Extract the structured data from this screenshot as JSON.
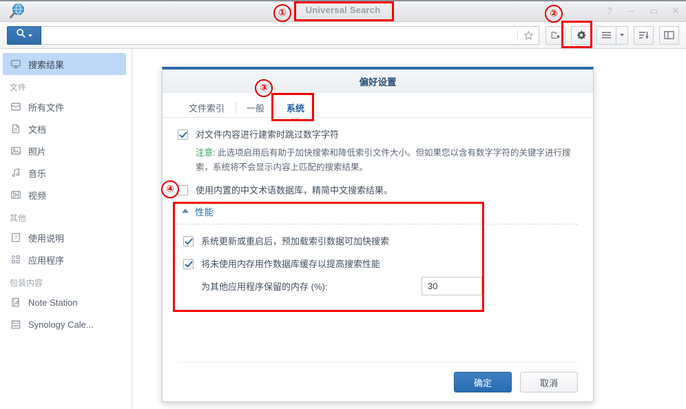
{
  "window": {
    "title": "Universal Search",
    "logo_icon": "magnifier-globe-icon",
    "buttons": [
      {
        "name": "help",
        "glyph": "?"
      },
      {
        "name": "minimize",
        "glyph": "–"
      },
      {
        "name": "maximize",
        "glyph": "▭"
      },
      {
        "name": "close",
        "glyph": "✕"
      }
    ]
  },
  "searchbar": {
    "scope_icon": "search-icon",
    "scope_caret_icon": "caret-down-icon",
    "query": "",
    "placeholder": "",
    "favorite_icon": "star-icon",
    "tools": [
      {
        "name": "new-folder-favorite",
        "icon": "folder-star-icon"
      },
      {
        "name": "settings",
        "icon": "gear-icon"
      },
      {
        "name": "list-view",
        "icon": "list-icon"
      },
      {
        "name": "list-view-more",
        "icon": "caret-down-icon"
      },
      {
        "name": "sort",
        "icon": "sort-descending-icon"
      },
      {
        "name": "panel",
        "icon": "layout-panel-icon"
      }
    ]
  },
  "sidebar": {
    "selected": {
      "label": "搜索结果",
      "icon": "monitor-icon"
    },
    "groups": [
      {
        "title": "文件",
        "items": [
          {
            "label": "所有文件",
            "icon": "archive-icon"
          },
          {
            "label": "文档",
            "icon": "document-icon"
          },
          {
            "label": "照片",
            "icon": "photo-icon"
          },
          {
            "label": "音乐",
            "icon": "music-icon"
          },
          {
            "label": "视频",
            "icon": "video-icon"
          }
        ]
      },
      {
        "title": "其他",
        "items": [
          {
            "label": "使用说明",
            "icon": "question-box-icon"
          },
          {
            "label": "应用程序",
            "icon": "apps-icon"
          }
        ]
      },
      {
        "title": "包装内容",
        "items": [
          {
            "label": "Note Station",
            "icon": "note-icon"
          },
          {
            "label": "Synology Cale...",
            "icon": "calendar-icon"
          }
        ]
      }
    ]
  },
  "dialog": {
    "title": "偏好设置",
    "tabs": [
      {
        "label": "文件索引",
        "active": false
      },
      {
        "label": "一般",
        "active": false
      },
      {
        "label": "系统",
        "active": true
      }
    ],
    "options": [
      {
        "label": "对文件内容进行建索时跳过数字字符",
        "checked": true
      },
      {
        "label": "使用内置的中文术语数据库，精简中文搜索结果。",
        "checked": false
      }
    ],
    "note": {
      "key": "注意:",
      "text": " 此选项启用后有助于加快搜索和降低索引文件大小。但如果您以含有数字字符的关键字进行搜索，系统将不会显示内容上匹配的搜索结果。"
    },
    "performance": {
      "title": "性能",
      "collapse_icon": "chevron-up-icon",
      "options": [
        {
          "label": "系统更新或重启后，预加载索引数据可加快搜索",
          "checked": true
        },
        {
          "label": "将未使用内存用作数据库缓存以提高搜索性能",
          "checked": true
        }
      ],
      "memory_label": "为其他应用程序保留的内存 (%):",
      "memory_value": "30"
    },
    "footer": {
      "ok": "确定",
      "cancel": "取消"
    }
  },
  "annotations": [
    {
      "number": "①"
    },
    {
      "number": "②"
    },
    {
      "number": "③"
    },
    {
      "number": "④"
    }
  ],
  "colors": {
    "accent": "#2a6cb3",
    "annotation": "#f40000",
    "sidebar_selected": "#bed8f7",
    "note_key": "#2f9e5c"
  }
}
